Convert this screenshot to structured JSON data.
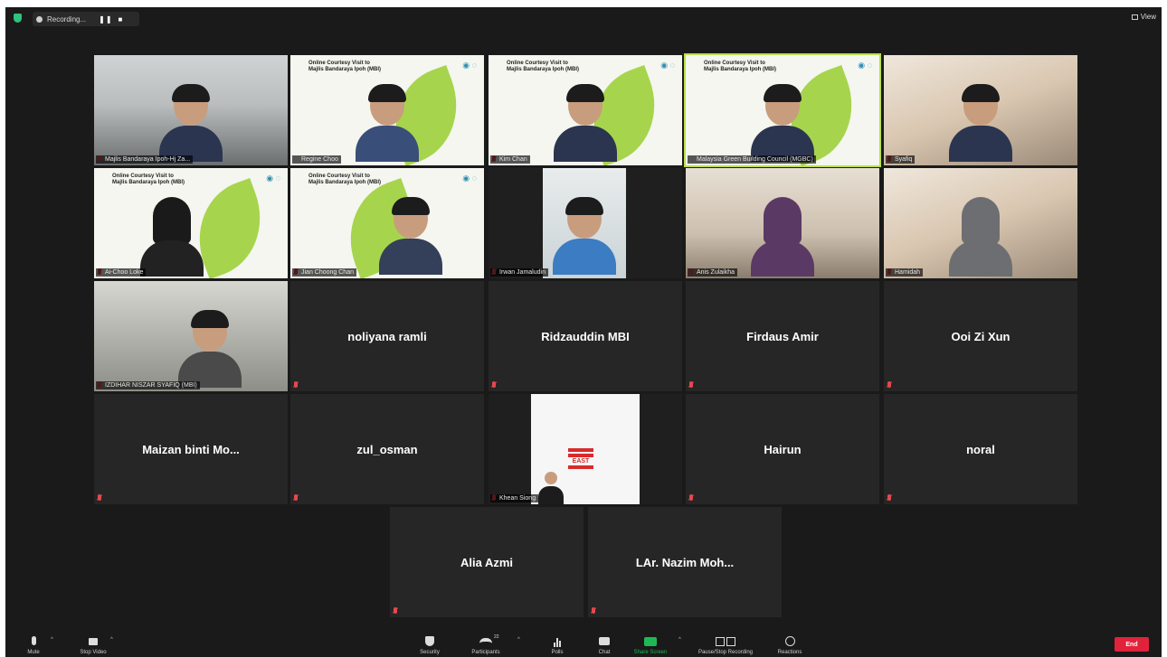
{
  "topbar": {
    "recording_label": "Recording...",
    "pause_label": "❚❚",
    "stop_label": "■",
    "view_label": "View"
  },
  "slide": {
    "title_line1": "Online Courtesy Visit to",
    "title_line2": "Majlis Bandaraya Ipoh (MBI)"
  },
  "participants": {
    "mbi": "Majlis Bandaraya Ipoh-Hj Za...",
    "regine": "Regine Choo",
    "kim": "Kim Chan",
    "msbc": "Malaysia Green Building Council (MGBC)",
    "s5": "Syafiq",
    "ai": "Ai-Choo Loke",
    "jian": "Jian Choong Chan",
    "irwan": "Irwan Jamaludin",
    "anis": "Anis Zulaikha",
    "hamidah": "Hamidah",
    "izdihar": "IZDIHAR NISZAR SYAFIQ (MBI)",
    "noliyana": "noliyana ramli",
    "ridzauddin": "Ridzauddin MBI",
    "firdaus": "Firdaus Amir",
    "ooi": "Ooi Zi Xun",
    "maizan": "Maizan binti Mo...",
    "zul": "zul_osman",
    "khean": "Khean Siong",
    "hairun": "Hairun",
    "noral": "noral",
    "alia": "Alia Azmi",
    "nazim": "LAr. Nazim Moh..."
  },
  "east_logo_text": "EAST",
  "toolbar": {
    "mute": "Mute",
    "stop_video": "Stop Video",
    "security": "Security",
    "participants": "Participants",
    "participants_count": "22",
    "polls": "Polls",
    "chat": "Chat",
    "share_screen": "Share Screen",
    "pause_recording": "Pause/Stop Recording",
    "reactions": "Reactions",
    "end": "End"
  },
  "colors": {
    "background": "#1a1a1a",
    "active_speaker": "#b8e04a",
    "muted": "#e5484d",
    "end_button": "#e0233b",
    "share_green": "#1fb954"
  }
}
